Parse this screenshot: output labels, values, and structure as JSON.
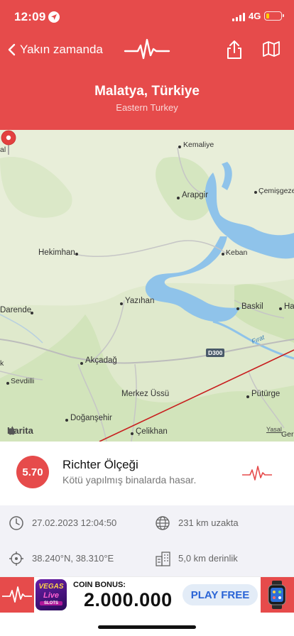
{
  "status_bar": {
    "time": "12:09",
    "network": "4G"
  },
  "nav": {
    "back_label": "Yakın zamanda"
  },
  "location": {
    "title": "Malatya, Türkiye",
    "region": "Eastern Turkey"
  },
  "map": {
    "places": [
      "Kemaliye",
      "Arapgir",
      "Çemişgezek",
      "Keban",
      "Hekimhan",
      "Yazıhan",
      "Baskil",
      "Darende",
      "Akçadağ",
      "Sevdilli",
      "Doğanşehir",
      "Çelikhan",
      "Pütürge",
      "Merkez Üssü"
    ],
    "road_sign": "D300",
    "river": "Fırat",
    "attribution": "Harita",
    "legal": "Yasal",
    "partial_labels": {
      "left_top": "al",
      "right_baskil": "Ha",
      "left_mid": "k",
      "right_bottom": "Ger"
    }
  },
  "richter": {
    "magnitude": "5.70",
    "title": "Richter Ölçeği",
    "description": "Kötü yapılmış binalarda hasar."
  },
  "details": {
    "datetime": "27.02.2023 12:04:50",
    "distance": "231 km uzakta",
    "coordinates": "38.240°N, 38.310°E",
    "depth": "5,0 km derinlik"
  },
  "ad": {
    "game_title_1": "VEGAS",
    "game_title_2": "Live",
    "game_title_3": "SLOTS",
    "bonus_label": "COIN BONUS:",
    "amount": "2.000.000",
    "cta": "PLAY FREE"
  },
  "colors": {
    "accent": "#e64b4b",
    "map_land": "#e9efdc",
    "water": "#8fc3ea"
  },
  "icons": [
    "location-arrow-icon",
    "back-chevron-icon",
    "pulse-logo-icon",
    "share-icon",
    "map-icon",
    "map-pin-icon",
    "clock-icon",
    "globe-icon",
    "crosshair-icon",
    "building-icon",
    "watch-icon"
  ]
}
